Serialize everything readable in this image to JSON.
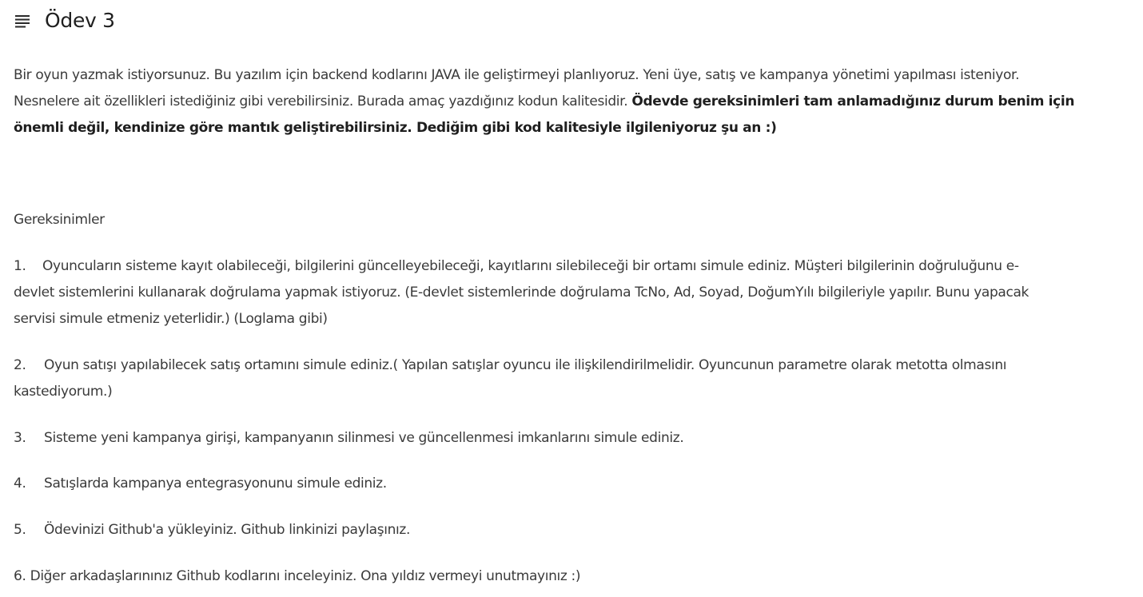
{
  "header": {
    "title": "Ödev 3",
    "icon": "menu-lines-icon"
  },
  "intro": {
    "line1": "Bir oyun yazmak istiyorsunuz. Bu yazılım için backend kodlarını JAVA ile geliştirmeyi planlıyoruz. Yeni üye, satış ve kampanya yönetimi yapılması isteniyor.",
    "line2_normal": "Nesnelere ait özellikleri istediğiniz gibi verebilirsiniz. Burada amaç yazdığınız kodun kalitesidir. ",
    "line2_bold": "Ödevde gereksinimleri tam anlamadığınız durum benim için",
    "line3_bold": "önemli değil, kendinize göre mantık geliştirebilirsiniz. Dediğim gibi kod kalitesiyle ilgileniyoruz şu an :)"
  },
  "requirements": {
    "heading": "Gereksinimler",
    "items": [
      {
        "number": "1.",
        "lines": [
          "Oyuncuların sisteme kayıt olabileceği, bilgilerini güncelleyebileceği, kayıtlarını silebileceği bir ortamı simule ediniz. Müşteri bilgilerinin doğruluğunu e-",
          "devlet sistemlerini kullanarak doğrulama yapmak istiyoruz. (E-devlet sistemlerinde doğrulama TcNo, Ad, Soyad, DoğumYılı bilgileriyle yapılır. Bunu yapacak",
          "servisi simule etmeniz yeterlidir.) (Loglama gibi)"
        ]
      },
      {
        "number": "2.",
        "lines": [
          "Oyun satışı yapılabilecek satış ortamını simule ediniz.( Yapılan satışlar oyuncu ile ilişkilendirilmelidir. Oyuncunun parametre olarak metotta olmasını",
          "kastediyorum.)"
        ]
      },
      {
        "number": "3.",
        "lines": [
          "Sisteme yeni kampanya girişi, kampanyanın silinmesi ve güncellenmesi imkanlarını simule ediniz."
        ]
      },
      {
        "number": "4.",
        "lines": [
          "Satışlarda kampanya entegrasyonunu simule ediniz."
        ]
      },
      {
        "number": "5.",
        "lines": [
          "Ödevinizi Github'a yükleyiniz. Github linkinizi paylaşınız."
        ]
      }
    ],
    "item6": "6. Diğer arkadaşlarınınız Github kodlarını inceleyiniz. Ona yıldız vermeyi unutmayınız :)"
  }
}
